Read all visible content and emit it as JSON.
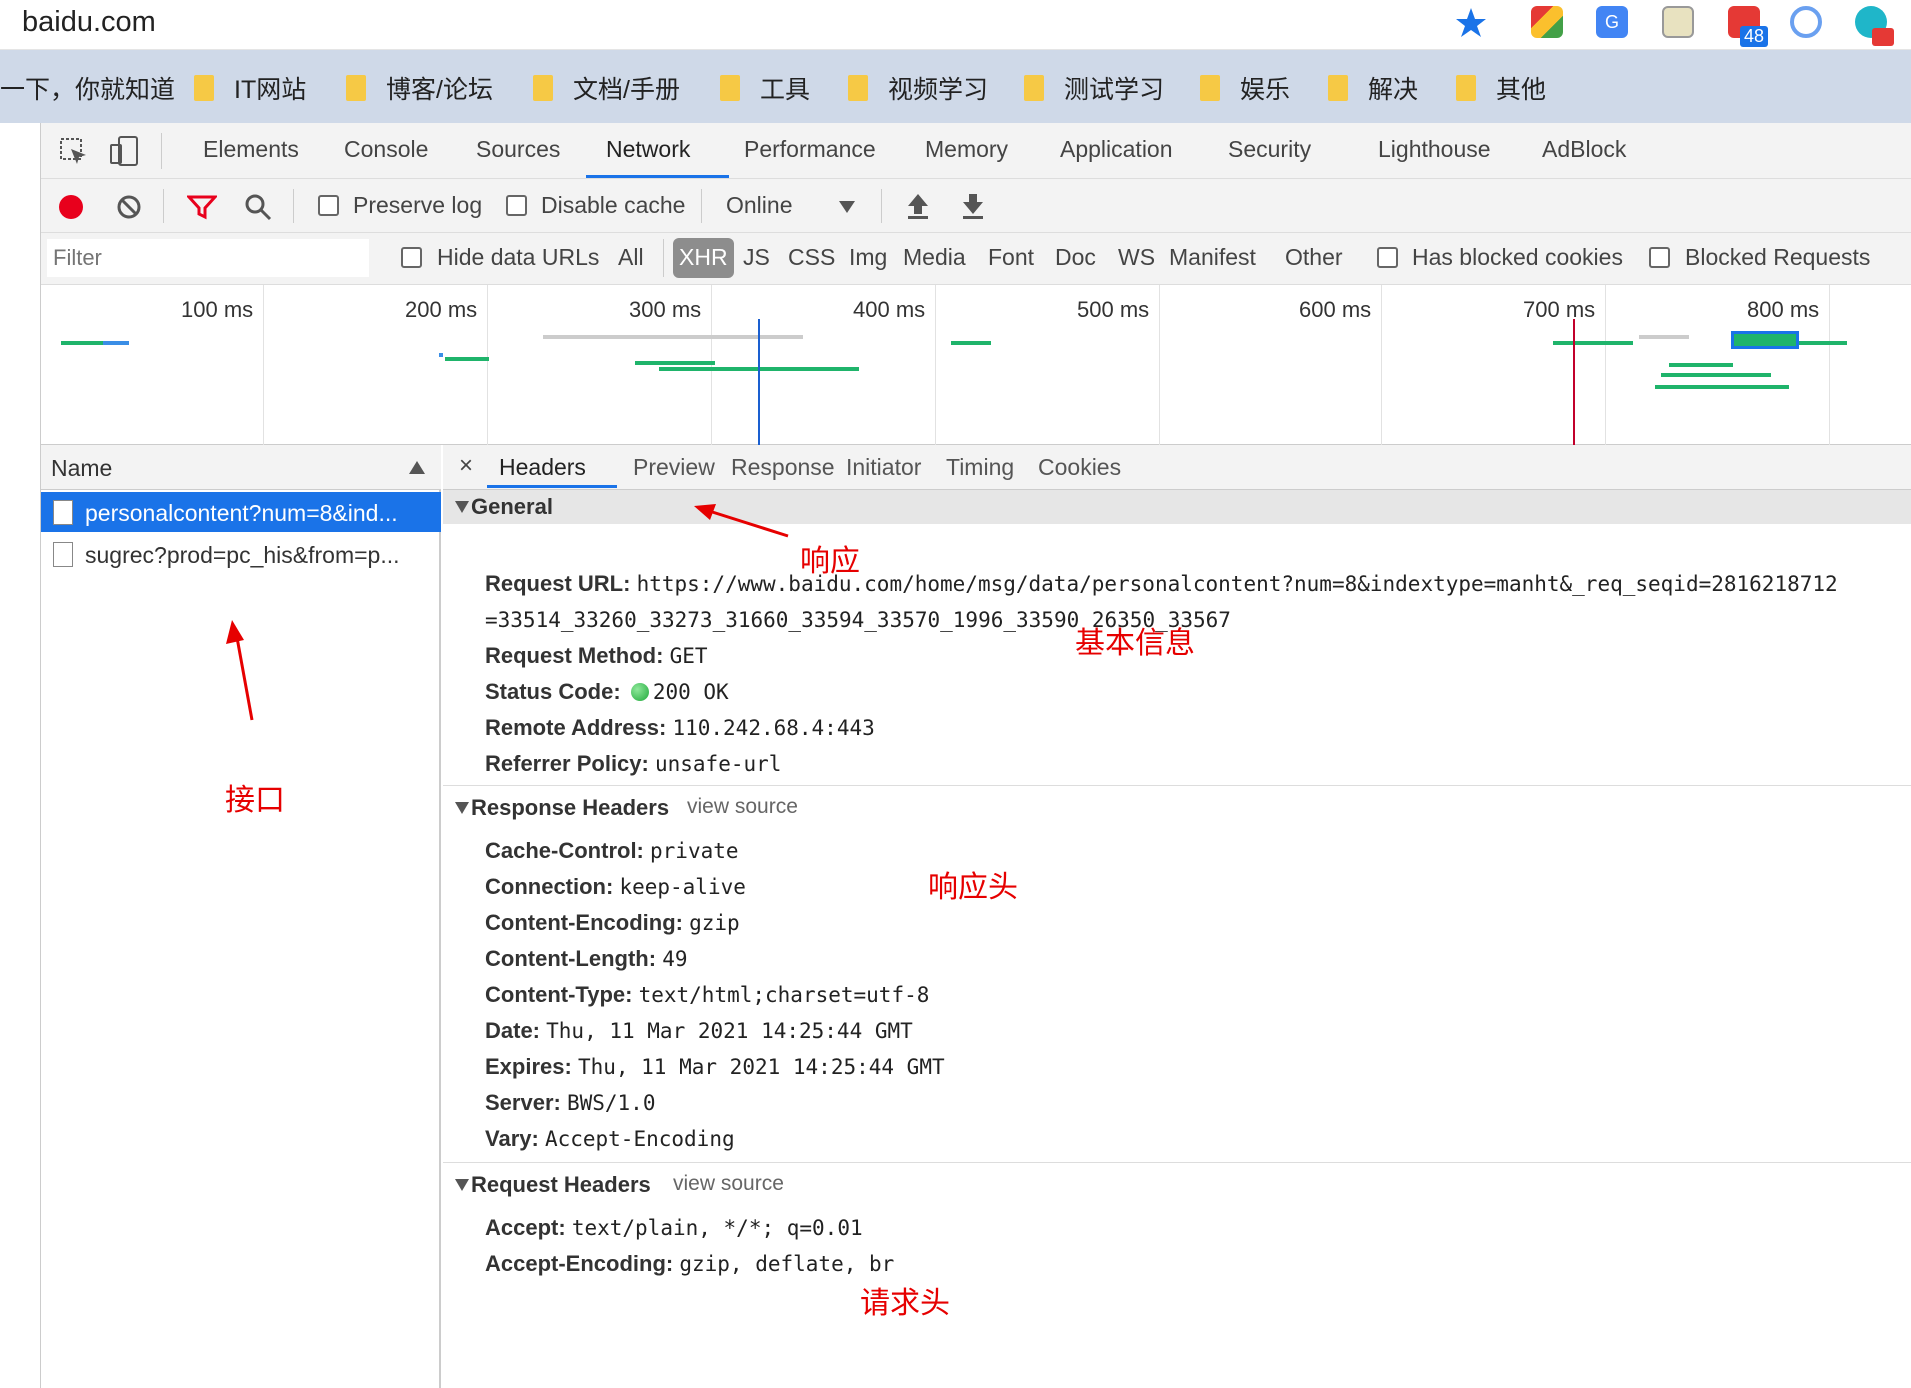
{
  "browser": {
    "url": "baidu.com",
    "badge": "48",
    "bookmarks": [
      "一下，你就知道",
      "IT网站",
      "博客/论坛",
      "文档/手册",
      "工具",
      "视频学习",
      "测试学习",
      "娱乐",
      "解决",
      "其他"
    ]
  },
  "devtools": {
    "tabs": [
      "Elements",
      "Console",
      "Sources",
      "Network",
      "Performance",
      "Memory",
      "Application",
      "Security",
      "Lighthouse",
      "AdBlock"
    ],
    "active_tab": "Network",
    "toolbar": {
      "preserve_log": "Preserve log",
      "disable_cache": "Disable cache",
      "throttle": "Online"
    },
    "filter": {
      "placeholder": "Filter",
      "hide_data_urls": "Hide data URLs",
      "types": [
        "All",
        "XHR",
        "JS",
        "CSS",
        "Img",
        "Media",
        "Font",
        "Doc",
        "WS",
        "Manifest",
        "Other"
      ],
      "active_type": "XHR",
      "has_blocked_cookies": "Has blocked cookies",
      "blocked_requests": "Blocked Requests"
    },
    "overview_ticks": [
      "100 ms",
      "200 ms",
      "300 ms",
      "400 ms",
      "500 ms",
      "600 ms",
      "700 ms",
      "800 ms"
    ],
    "name_header": "Name",
    "requests": [
      "personalcontent?num=8&ind...",
      "sugrec?prod=pc_his&from=p..."
    ],
    "detail_tabs": [
      "Headers",
      "Preview",
      "Response",
      "Initiator",
      "Timing",
      "Cookies"
    ],
    "general": {
      "title": "General",
      "url_label": "Request URL:",
      "url_line1": "https://www.baidu.com/home/msg/data/personalcontent?num=8&indextype=manht&_req_seqid=2816218712",
      "url_line2": "=33514_33260_33273_31660_33594_33570_1996_33590_26350_33567",
      "method_label": "Request Method:",
      "method": "GET",
      "status_label": "Status Code:",
      "status": "200 OK",
      "remote_label": "Remote Address:",
      "remote": "110.242.68.4:443",
      "referrer_label": "Referrer Policy:",
      "referrer": "unsafe-url"
    },
    "response_headers": {
      "title": "Response Headers",
      "view_source": "view source",
      "items": [
        {
          "k": "Cache-Control:",
          "v": "private"
        },
        {
          "k": "Connection:",
          "v": "keep-alive"
        },
        {
          "k": "Content-Encoding:",
          "v": "gzip"
        },
        {
          "k": "Content-Length:",
          "v": "49"
        },
        {
          "k": "Content-Type:",
          "v": "text/html;charset=utf-8"
        },
        {
          "k": "Date:",
          "v": "Thu, 11 Mar 2021 14:25:44 GMT"
        },
        {
          "k": "Expires:",
          "v": "Thu, 11 Mar 2021 14:25:44 GMT"
        },
        {
          "k": "Server:",
          "v": "BWS/1.0"
        },
        {
          "k": "Vary:",
          "v": "Accept-Encoding"
        }
      ]
    },
    "request_headers": {
      "title": "Request Headers",
      "view_source": "view source",
      "accept_label": "Accept:",
      "accept": "text/plain, */*; q=0.01",
      "accept_enc_label": "Accept-Encoding:",
      "accept_enc": "gzip, deflate, br"
    }
  },
  "annotations": {
    "response": "响应",
    "basic_info": "基本信息",
    "interface": "接口",
    "response_headers": "响应头",
    "request_headers": "请求头"
  },
  "colors": {
    "accent": "#1a73e8",
    "annotation": "#e60000",
    "record": "#e8001c",
    "status_ok": "#1fa83a"
  }
}
